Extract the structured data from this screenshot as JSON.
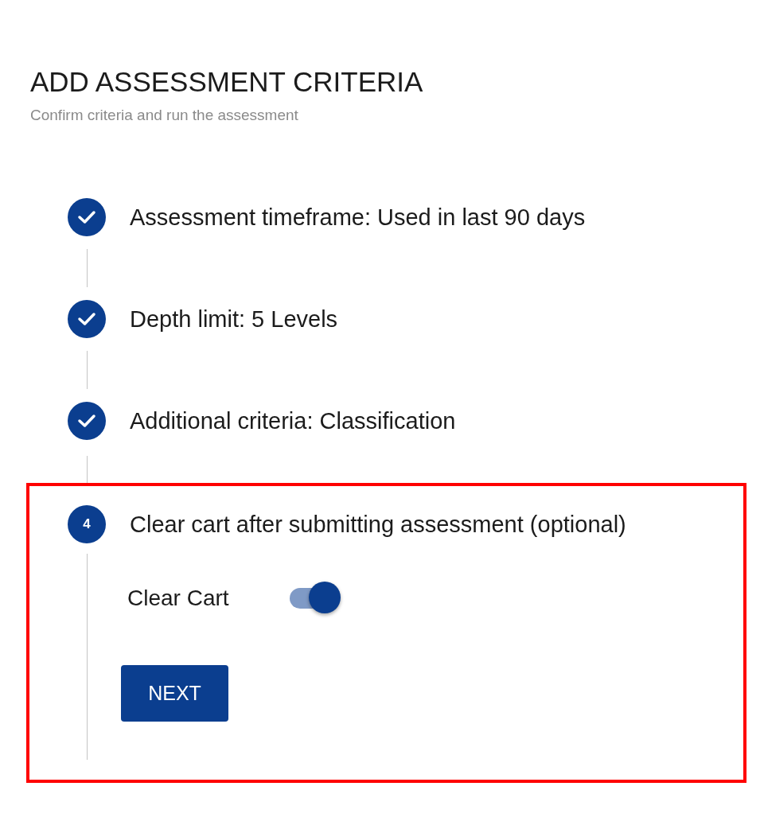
{
  "header": {
    "title": "ADD ASSESSMENT CRITERIA",
    "subtitle": "Confirm criteria and run the assessment"
  },
  "steps": [
    {
      "kind": "done",
      "highlighted": false,
      "label": "Assessment timeframe: Used in last 90 days"
    },
    {
      "kind": "done",
      "highlighted": false,
      "label": "Depth limit: 5 Levels"
    },
    {
      "kind": "done",
      "highlighted": false,
      "label": "Additional criteria: Classification"
    },
    {
      "kind": "active",
      "highlighted": true,
      "number": "4",
      "label": "Clear cart after submitting assessment (optional)",
      "toggle": {
        "label": "Clear Cart",
        "on": true
      },
      "button": "NEXT"
    }
  ]
}
